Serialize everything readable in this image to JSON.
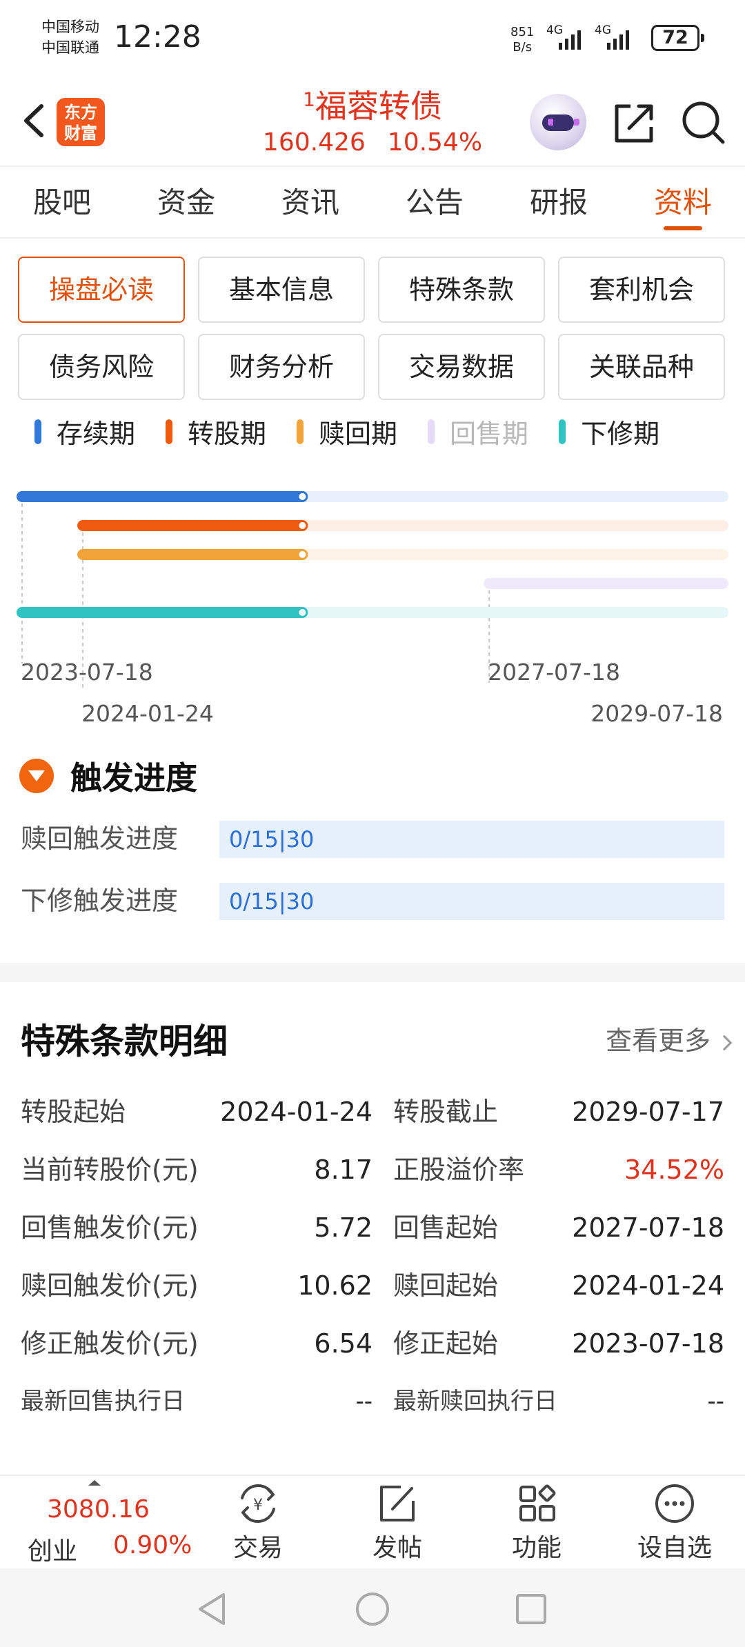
{
  "status": {
    "carrier1": "中国移动",
    "carrier2": "中国联通",
    "time": "12:28",
    "net_speed_value": "851",
    "net_speed_unit": "B/s",
    "signal1": "4G",
    "signal2": "4G",
    "battery": "72"
  },
  "header": {
    "logo_line1": "东方",
    "logo_line2": "财富",
    "title_badge": "1",
    "title": "福蓉转债",
    "price": "160.426",
    "change_pct": "10.54%",
    "color_up": "#e0331e",
    "accent": "#e0520c"
  },
  "tabs": [
    {
      "label": "股吧"
    },
    {
      "label": "资金"
    },
    {
      "label": "资讯"
    },
    {
      "label": "公告"
    },
    {
      "label": "研报"
    },
    {
      "label": "资料",
      "active": true
    }
  ],
  "sub_tabs": [
    {
      "label": "操盘必读",
      "active": true
    },
    {
      "label": "基本信息"
    },
    {
      "label": "特殊条款"
    },
    {
      "label": "套利机会"
    },
    {
      "label": "债务风险"
    },
    {
      "label": "财务分析"
    },
    {
      "label": "交易数据"
    },
    {
      "label": "关联品种"
    }
  ],
  "legend": [
    {
      "label": "存续期",
      "color": "#3278d8"
    },
    {
      "label": "转股期",
      "color": "#f05a0f"
    },
    {
      "label": "赎回期",
      "color": "#f2a43a"
    },
    {
      "label": "回售期",
      "color": "#e4dcf6",
      "muted": true
    },
    {
      "label": "下修期",
      "color": "#2fc4c2"
    }
  ],
  "timeline": {
    "dates": [
      "2023-07-18",
      "2024-01-24",
      "2027-07-18",
      "2029-07-18"
    ],
    "current_progress": 0.4,
    "tracks": [
      {
        "name": "存续期",
        "color": "#3278d8",
        "bg": "#e7f0fb",
        "start": "2023-07-18",
        "end": "2029-07-18"
      },
      {
        "name": "转股期",
        "color": "#f05a0f",
        "bg": "#fdeee6",
        "start": "2024-01-24",
        "end": "2029-07-18"
      },
      {
        "name": "赎回期",
        "color": "#f2a43a",
        "bg": "#fdf3e6",
        "start": "2024-01-24",
        "end": "2029-07-18"
      },
      {
        "name": "回售期",
        "color": "#e4dcf6",
        "bg": "#efeafb",
        "start": "2027-07-18",
        "end": "2029-07-18"
      },
      {
        "name": "下修期",
        "color": "#2fc4c2",
        "bg": "#e6f7f7",
        "start": "2023-07-18",
        "end": "2029-07-18"
      }
    ]
  },
  "trigger": {
    "title": "触发进度",
    "rows": [
      {
        "label": "赎回触发进度",
        "value": "0/15|30"
      },
      {
        "label": "下修触发进度",
        "value": "0/15|30"
      }
    ]
  },
  "terms": {
    "title": "特殊条款明细",
    "more": "查看更多",
    "rows": [
      {
        "l1": "转股起始",
        "v1": "2024-01-24",
        "l2": "转股截止",
        "v2": "2029-07-17"
      },
      {
        "l1": "当前转股价(元)",
        "v1": "8.17",
        "l2": "正股溢价率",
        "v2": "34.52%"
      },
      {
        "l1": "回售触发价(元)",
        "v1": "5.72",
        "l2": "回售起始",
        "v2": "2027-07-18"
      },
      {
        "l1": "赎回触发价(元)",
        "v1": "10.62",
        "l2": "赎回起始",
        "v2": "2024-01-24"
      },
      {
        "l1": "修正触发价(元)",
        "v1": "6.54",
        "l2": "修正起始",
        "v2": "2023-07-18"
      },
      {
        "l1": "最新回售执行日",
        "v1": "--",
        "l2": "最新赎回执行日",
        "v2": "--"
      }
    ]
  },
  "toolbar": {
    "index_value": "3080.16",
    "index_name": "创业",
    "index_change": "0.90%",
    "items": [
      {
        "label": "交易",
        "icon": "trade-icon"
      },
      {
        "label": "发帖",
        "icon": "post-icon"
      },
      {
        "label": "功能",
        "icon": "apps-icon"
      },
      {
        "label": "设自选",
        "icon": "more-icon"
      }
    ]
  }
}
